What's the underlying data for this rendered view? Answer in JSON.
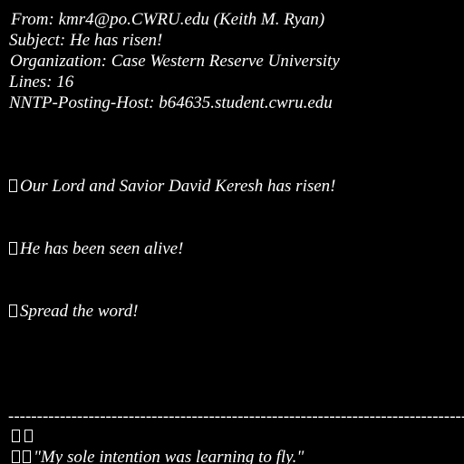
{
  "header": {
    "from": "From: kmr4@po.CWRU.edu (Keith M. Ryan)",
    "subject": "Subject: He has risen!",
    "organization": "Organization: Case Western Reserve University",
    "lines": "Lines: 16",
    "nntp_host": "NNTP-Posting-Host: b64635.student.cwru.edu"
  },
  "body": {
    "paragraph_1": "Our Lord and Savior David Keresh has risen!",
    "paragraph_2": "He has been seen alive!",
    "paragraph_3": "Spread the word!"
  },
  "signature": {
    "divider": "--------------------------------------------------------------------------------",
    "quote": "\"My sole intention was learning to fly.\""
  }
}
